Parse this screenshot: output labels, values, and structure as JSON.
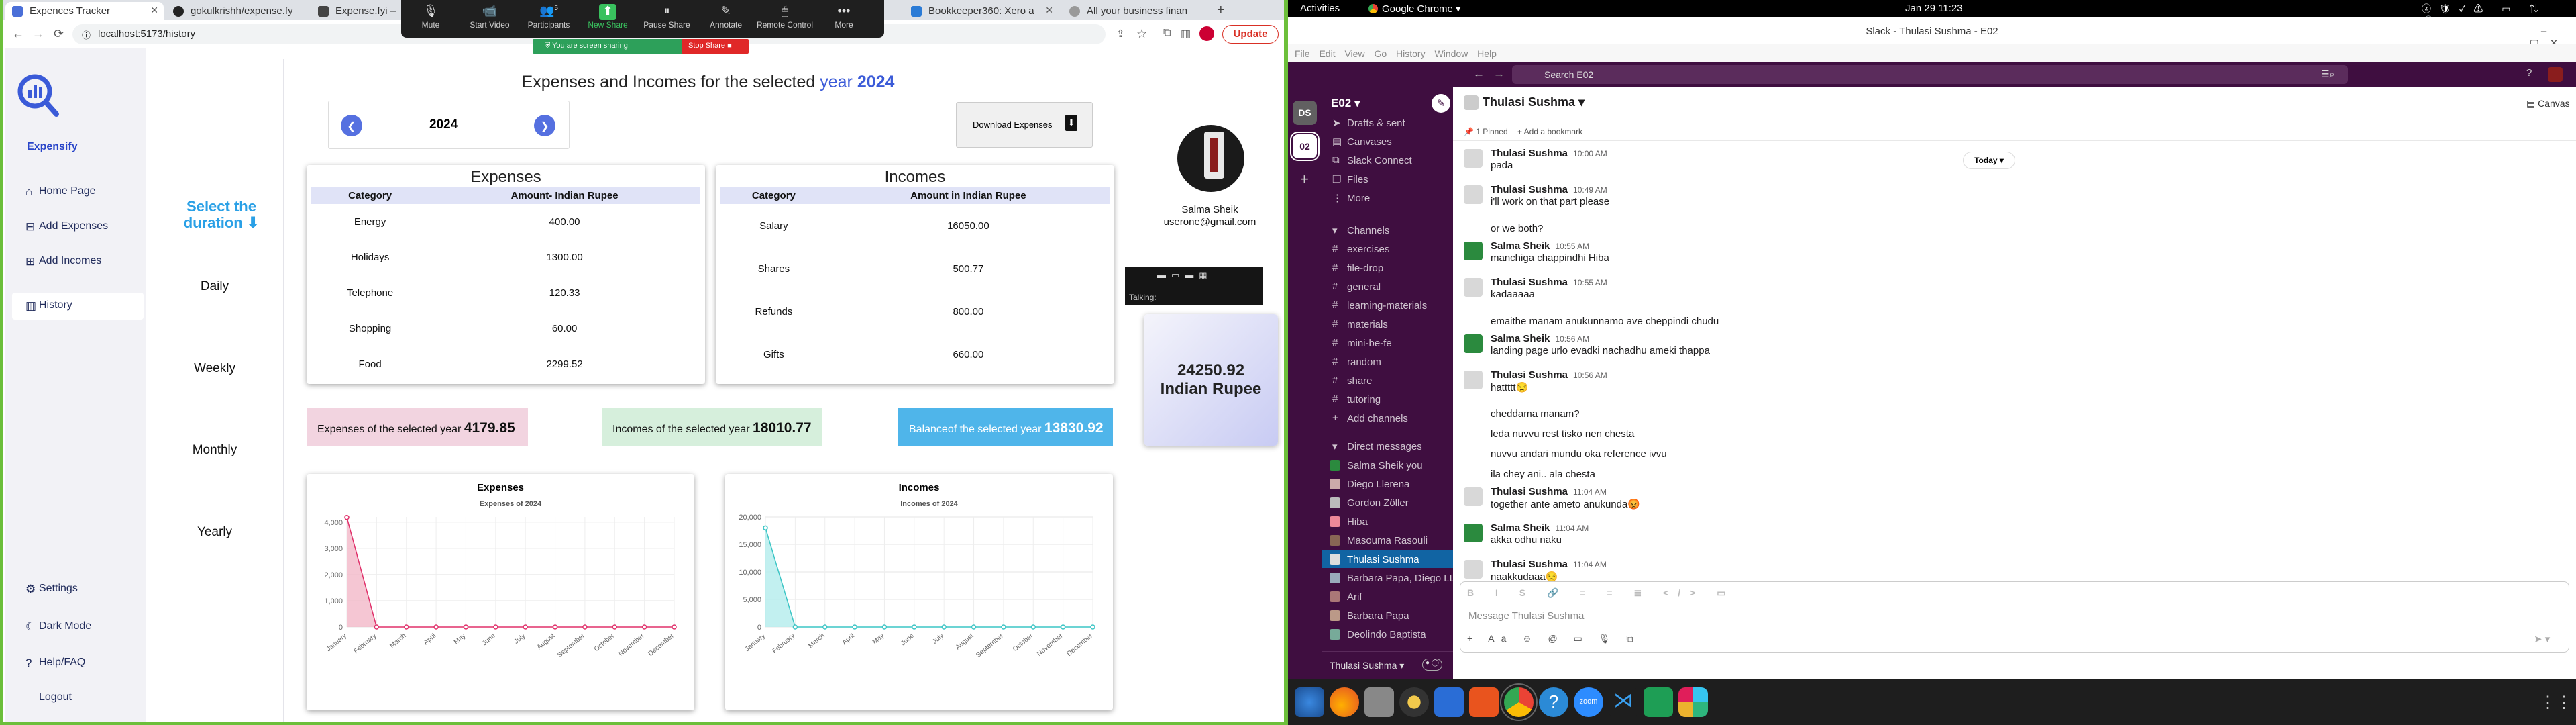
{
  "browser": {
    "tabs": [
      "Expences Tracker",
      "gokulkrishh/expense.fy",
      "Expense.fyi – T",
      "Bookkeeper360: Xero a",
      "All your business finan"
    ],
    "url": "localhost:5173/history",
    "update_label": "Update"
  },
  "zoom": {
    "items": [
      {
        "label": "Mute",
        "icon": "🎙"
      },
      {
        "label": "Start Video",
        "icon": "📹"
      },
      {
        "label": "Participants",
        "icon": "👥",
        "count": "5"
      },
      {
        "label": "New Share",
        "icon": "⬆"
      },
      {
        "label": "Pause Share",
        "icon": "⏸"
      },
      {
        "label": "Annotate",
        "icon": "✎"
      },
      {
        "label": "Remote Control",
        "icon": "🖱"
      },
      {
        "label": "More",
        "icon": "•••"
      }
    ],
    "sharing": "You are screen sharing",
    "stop": "Stop Share",
    "talking": "Talking:"
  },
  "app": {
    "brand": "Expensify",
    "nav": [
      "Home Page",
      "Add Expenses",
      "Add Incomes",
      "History"
    ],
    "bottom_nav": [
      "Settings",
      "Dark Mode",
      "Help/FAQ",
      "Logout"
    ],
    "select_duration": "Select the duration ⬇",
    "durations": [
      "Daily",
      "Weekly",
      "Monthly",
      "Yearly"
    ],
    "title_prefix": "Expenses and Incomes for the selected",
    "title_year_word": "year",
    "title_year": "2024",
    "year": "2024",
    "download": "Download Expenses",
    "user_name": "Salma Sheik",
    "user_email": "userone@gmail.com",
    "balance_amount": "24250.92",
    "balance_currency": "Indian Rupee",
    "expenses_table": {
      "title": "Expenses",
      "headers": [
        "Category",
        "Amount- Indian Rupee"
      ],
      "rows": [
        [
          "Energy",
          "400.00"
        ],
        [
          "Holidays",
          "1300.00"
        ],
        [
          "Telephone",
          "120.33"
        ],
        [
          "Shopping",
          "60.00"
        ],
        [
          "Food",
          "2299.52"
        ]
      ]
    },
    "incomes_table": {
      "title": "Incomes",
      "headers": [
        "Category",
        "Amount in Indian Rupee"
      ],
      "rows": [
        [
          "Salary",
          "16050.00"
        ],
        [
          "Shares",
          "500.77"
        ],
        [
          "Refunds",
          "800.00"
        ],
        [
          "Gifts",
          "660.00"
        ]
      ]
    },
    "summary": {
      "expenses_label": "Expenses of the selected year",
      "expenses_value": "4179.85",
      "incomes_label": "Incomes of the selected year",
      "incomes_value": "18010.77",
      "balance_label": "Balanceof the selected year",
      "balance_value": "13830.92"
    }
  },
  "chart_data": [
    {
      "type": "line",
      "title": "Expenses of 2024",
      "card_title": "Expenses",
      "categories": [
        "January",
        "February",
        "March",
        "April",
        "May",
        "June",
        "July",
        "August",
        "September",
        "October",
        "November",
        "December"
      ],
      "values": [
        4180,
        0,
        0,
        0,
        0,
        0,
        0,
        0,
        0,
        0,
        0,
        0
      ],
      "yticks": [
        0,
        1000,
        2000,
        3000,
        4000
      ],
      "ytick_labels": [
        "0",
        "1,000",
        "2,000",
        "3,000",
        "4,000"
      ],
      "ylim": [
        0,
        4200
      ],
      "color": "#e0306a",
      "fill": "#f3b8c8"
    },
    {
      "type": "line",
      "title": "Incomes of 2024",
      "card_title": "Incomes",
      "categories": [
        "January",
        "February",
        "March",
        "April",
        "May",
        "June",
        "July",
        "August",
        "September",
        "October",
        "November",
        "December"
      ],
      "values": [
        18010,
        0,
        0,
        0,
        0,
        0,
        0,
        0,
        0,
        0,
        0,
        0
      ],
      "yticks": [
        0,
        5000,
        10000,
        15000,
        20000
      ],
      "ytick_labels": [
        "0",
        "5,000",
        "10,000",
        "15,000",
        "20,000"
      ],
      "ylim": [
        0,
        20000
      ],
      "color": "#3cc5c5",
      "fill": "#b3ecec"
    }
  ],
  "gnome": {
    "activities": "Activities",
    "app": "Google Chrome ▾",
    "clock": "Jan 29  11:23"
  },
  "slack": {
    "window_title": "Slack - Thulasi Sushma - E02",
    "menu": [
      "File",
      "Edit",
      "View",
      "Go",
      "History",
      "Window",
      "Help"
    ],
    "search": "Search E02",
    "workspace": "E02",
    "rail": [
      "DS",
      "02"
    ],
    "top_items": [
      "Drafts & sent",
      "Canvases",
      "Slack Connect",
      "Files",
      "More"
    ],
    "channels_header": "Channels",
    "channels": [
      "exercises",
      "file-drop",
      "general",
      "learning-materials",
      "materials",
      "mini-be-fe",
      "random",
      "share",
      "tutoring"
    ],
    "add_channels": "Add channels",
    "dm_header": "Direct messages",
    "dms": [
      "Salma Sheik  you",
      "Diego Llerena",
      "Gordon Zöller",
      "Hiba",
      "Masouma Rasouli",
      "Thulasi Sushma",
      "Barbara Papa, Diego LLeren...",
      "Arif",
      "Barbara Papa",
      "Deolindo Baptista"
    ],
    "footer_user": "Thulasi Sushma",
    "channel_title": "Thulasi Sushma",
    "pinned": "1 Pinned",
    "add_bookmark": "+ Add a bookmark",
    "canvas": "Canvas",
    "today": "Today ▾",
    "messages": [
      {
        "name": "Thulasi Sushma",
        "time": "10:00 AM",
        "text": "pada",
        "av": "t"
      },
      {
        "name": "Thulasi Sushma",
        "time": "10:49 AM",
        "text": "i'll work on that part please",
        "av": "t"
      },
      {
        "name": "",
        "time": "",
        "text": "or we both?",
        "av": ""
      },
      {
        "name": "Salma Sheik",
        "time": "10:55 AM",
        "text": "manchiga chappindhi Hiba",
        "av": "s"
      },
      {
        "name": "Thulasi Sushma",
        "time": "10:55 AM",
        "text": "kadaaaaa",
        "av": "t"
      },
      {
        "name": "",
        "time": "",
        "text": "emaithe manam anukunnamo ave cheppindi chudu",
        "av": ""
      },
      {
        "name": "Salma Sheik",
        "time": "10:56 AM",
        "text": "landing page urlo evadki nachadhu ameki thappa",
        "av": "s"
      },
      {
        "name": "Thulasi Sushma",
        "time": "10:56 AM",
        "text": "hattttt😒",
        "av": "t"
      },
      {
        "name": "",
        "time": "",
        "text": "cheddama manam?",
        "av": ""
      },
      {
        "name": "",
        "time": "",
        "text": "leda nuvvu rest tisko nen chesta",
        "av": ""
      },
      {
        "name": "",
        "time": "",
        "text": "nuvvu andari mundu oka reference ivvu",
        "av": ""
      },
      {
        "name": "",
        "time": "",
        "text": "ila chey ani.. ala chesta",
        "av": ""
      },
      {
        "name": "Thulasi Sushma",
        "time": "11:04 AM",
        "text": "together ante ameto anukunda😡",
        "av": "t"
      },
      {
        "name": "Salma Sheik",
        "time": "11:04 AM",
        "text": "akka odhu naku",
        "av": "s"
      },
      {
        "name": "Thulasi Sushma",
        "time": "11:04 AM",
        "text": "naakkudaaa😒",
        "av": "t"
      }
    ],
    "composer_placeholder": "Message Thulasi Sushma"
  }
}
